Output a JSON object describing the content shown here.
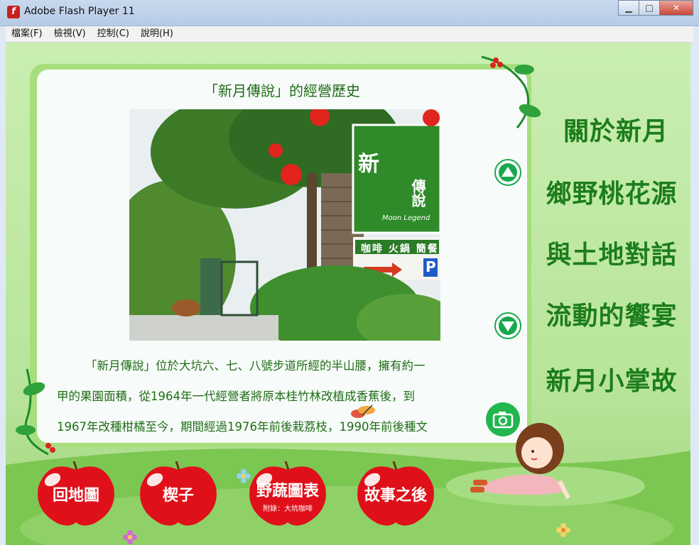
{
  "window": {
    "title": "Adobe Flash Player 11",
    "icon": "flash-icon"
  },
  "menu": {
    "file": "檔案(F)",
    "view": "檢視(V)",
    "control": "控制(C)",
    "help": "說明(H)"
  },
  "panel": {
    "title": "「新月傳說」的經營歷史",
    "photo_sign": {
      "big_char": "新",
      "name": "傳說",
      "subtitle": "Moon Legend",
      "menu_line": "咖啡 火鍋 簡餐",
      "parking": "P"
    },
    "lines": [
      "「新月傳說」位於大坑六、七、八號步道所經的半山腰，擁有約一",
      "甲的果園面積，從1964年一代經營者將原本桂竹林改植成香蕉後，到",
      "1967年改種柑橘至今，期間經過1976年前後栽荔枝，1990年前後種文"
    ]
  },
  "side_nav": [
    "關於新月",
    "鄉野桃花源",
    "與土地對話",
    "流動的饗宴",
    "新月小掌故"
  ],
  "bottom_buttons": [
    {
      "label": "回地圖"
    },
    {
      "label": "楔子"
    },
    {
      "label": "野蔬圖表",
      "sub": "附錄：大坑咖啡"
    },
    {
      "label": "故事之後"
    }
  ],
  "colors": {
    "accent": "#1c7d1c",
    "panel_bg": "#f7fbf9",
    "apple": "#e0101a",
    "button_green": "#22b64f"
  }
}
